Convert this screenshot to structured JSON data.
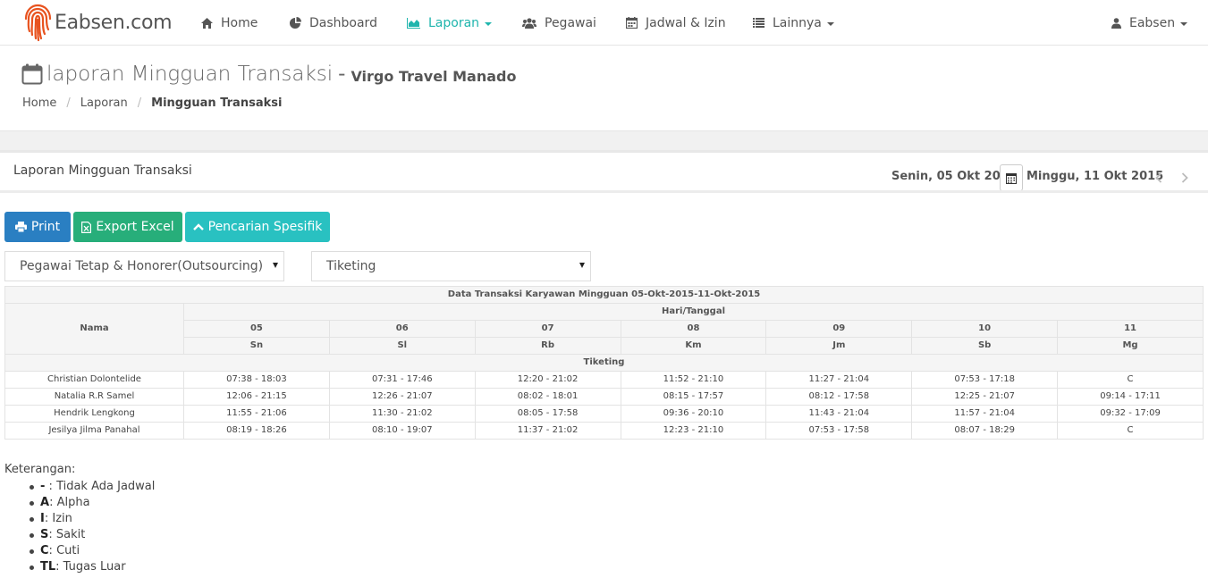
{
  "brand": {
    "name": "Eabsen.com",
    "accent": "#e8531f"
  },
  "nav": {
    "items": [
      {
        "label": "Home",
        "icon": "home-icon"
      },
      {
        "label": "Dashboard",
        "icon": "pie-chart-icon"
      },
      {
        "label": "Laporan",
        "icon": "area-chart-icon",
        "active": true
      },
      {
        "label": "Pegawai",
        "icon": "users-icon"
      },
      {
        "label": "Jadwal & Izin",
        "icon": "calendar-icon"
      },
      {
        "label": "Lainnya",
        "icon": "list-icon"
      }
    ],
    "user": "Eabsen",
    "active_color": "#1fb5ad"
  },
  "page": {
    "title": "laporan Mingguan Transaksi",
    "dash": "-",
    "subtitle": "Virgo Travel Manado",
    "breadcrumb": [
      "Home",
      "Laporan",
      "Mingguan Transaksi"
    ],
    "breadcrumb_sep": "/"
  },
  "panel": {
    "title": "Laporan Mingguan Transaksi",
    "date_from": "Senin, 05 Okt 2015",
    "date_to": "Minggu, 11 Okt 2015"
  },
  "buttons": {
    "print": "Print",
    "excel": "Export Excel",
    "search": "Pencarian Spesifik",
    "colors": {
      "print": "#2a7fc2",
      "excel": "#27ae7a",
      "search": "#29c1c1"
    }
  },
  "filters": {
    "employee_type": "Pegawai Tetap & Honorer(Outsourcing)",
    "department": "Tiketing"
  },
  "table": {
    "caption": "Data Transaksi Karyawan Mingguan 05-Okt-2015-11-Okt-2015",
    "name_header": "Nama",
    "group_header": "Hari/Tanggal",
    "dates": [
      "05",
      "06",
      "07",
      "08",
      "09",
      "10",
      "11"
    ],
    "days": [
      "Sn",
      "Sl",
      "Rb",
      "Km",
      "Jm",
      "Sb",
      "Mg"
    ],
    "section": "Tiketing",
    "rows": [
      {
        "name": "Christian Dolontelide",
        "cells": [
          "07:38 - 18:03",
          "07:31 - 17:46",
          "12:20 - 21:02",
          "11:52 - 21:10",
          "11:27 - 21:04",
          "07:53 - 17:18",
          "C"
        ]
      },
      {
        "name": "Natalia R.R Samel",
        "cells": [
          "12:06 - 21:15",
          "12:26 - 21:07",
          "08:02 - 18:01",
          "08:15 - 17:57",
          "08:12 - 17:58",
          "12:25 - 21:07",
          "09:14 - 17:11"
        ]
      },
      {
        "name": "Hendrik Lengkong",
        "cells": [
          "11:55 - 21:06",
          "11:30 - 21:02",
          "08:05 - 17:58",
          "09:36 - 20:10",
          "11:43 - 21:04",
          "11:57 - 21:04",
          "09:32 - 17:09"
        ]
      },
      {
        "name": "Jesilya Jilma Panahal",
        "cells": [
          "08:19 - 18:26",
          "08:10 - 19:07",
          "11:37 - 21:02",
          "12:23 - 21:10",
          "07:53 - 17:58",
          "08:07 - 18:29",
          "C"
        ]
      }
    ]
  },
  "legend": {
    "title": "Keterangan:",
    "items": [
      {
        "code": "-",
        "sep": " : ",
        "desc": "Tidak Ada Jadwal"
      },
      {
        "code": "A",
        "sep": ": ",
        "desc": "Alpha"
      },
      {
        "code": "I",
        "sep": ": ",
        "desc": "Izin"
      },
      {
        "code": "S",
        "sep": ": ",
        "desc": "Sakit"
      },
      {
        "code": "C",
        "sep": ": ",
        "desc": "Cuti"
      },
      {
        "code": "TL",
        "sep": ": ",
        "desc": "Tugas Luar"
      }
    ]
  }
}
